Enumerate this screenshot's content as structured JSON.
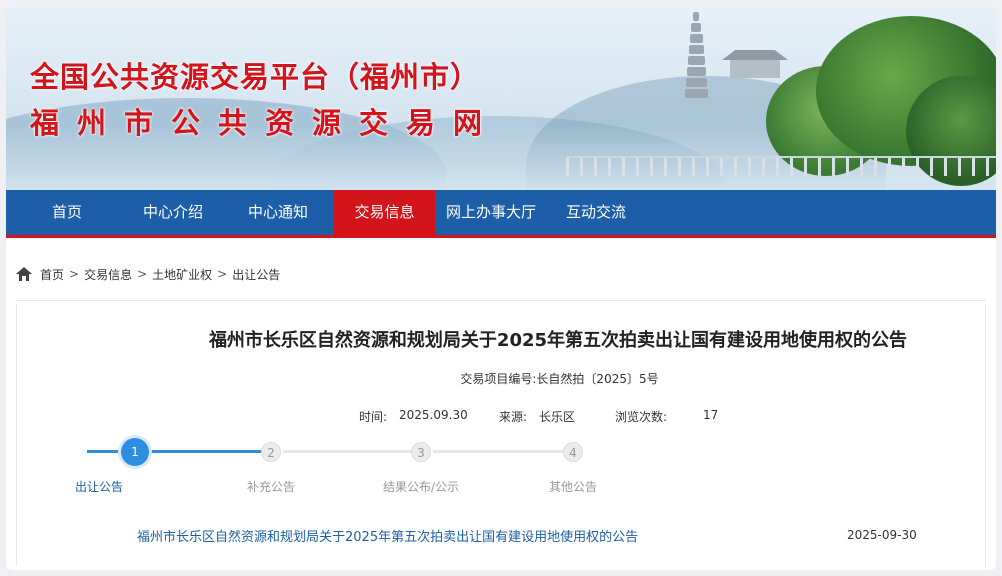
{
  "header": {
    "title_line1": "全国公共资源交易平台（福州市）",
    "title_line2": "福州市公共资源交易网"
  },
  "nav": {
    "items": [
      {
        "label": "首页",
        "active": false
      },
      {
        "label": "中心介绍",
        "active": false
      },
      {
        "label": "中心通知",
        "active": false
      },
      {
        "label": "交易信息",
        "active": true
      },
      {
        "label": "网上办事大厅",
        "active": false
      },
      {
        "label": "互动交流",
        "active": false
      }
    ]
  },
  "breadcrumb": {
    "items": [
      "首页",
      "交易信息",
      "土地矿业权",
      "出让公告"
    ],
    "separator": ">"
  },
  "article": {
    "title": "福州市长乐区自然资源和规划局关于2025年第五次拍卖出让国有建设用地使用权的公告",
    "project_no": "交易项目编号:长自然拍〔2025〕5号",
    "time_label": "时间:",
    "time_value": "2025.09.30",
    "source_label": "来源:",
    "source_value": "长乐区",
    "views_label": "浏览次数:",
    "views_value": "17"
  },
  "steps": [
    {
      "number": "1",
      "label": "出让公告",
      "active": true
    },
    {
      "number": "2",
      "label": "补充公告",
      "active": false
    },
    {
      "number": "3",
      "label": "结果公布/公示",
      "active": false
    },
    {
      "number": "4",
      "label": "其他公告",
      "active": false
    }
  ],
  "documents": [
    {
      "title": "福州市长乐区自然资源和规划局关于2025年第五次拍卖出让国有建设用地使用权的公告",
      "date": "2025-09-30"
    }
  ],
  "colors": {
    "primary_blue": "#1d5ea8",
    "accent_red": "#d4141b",
    "step_active": "#2e8de0"
  }
}
